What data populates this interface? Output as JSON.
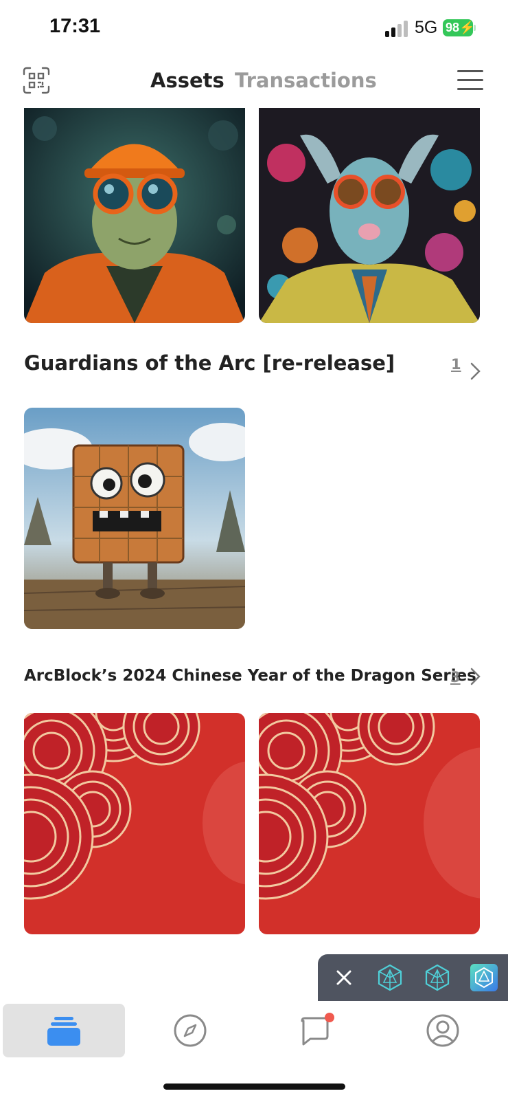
{
  "status_bar": {
    "time": "17:31",
    "network": "5G",
    "battery": "98"
  },
  "header": {
    "tabs": [
      {
        "label": "Assets",
        "active": true
      },
      {
        "label": "Transactions",
        "active": false
      }
    ],
    "scan_icon": "qr-scan-icon",
    "menu_icon": "hamburger-menu-icon"
  },
  "sections": [
    {
      "title": "Guardians of the Arc [re-release]",
      "count": "1",
      "items": [
        "robot-block-nft"
      ]
    },
    {
      "title": "ArcBlock’s 2024 Chinese Year of the Dragon Series",
      "count": "3",
      "items": [
        "dragon-red-envelope-nft",
        "dragon-red-envelope-nft"
      ]
    }
  ],
  "top_items": [
    "frog-goggles-nft",
    "goat-suit-nft"
  ],
  "floating_bar": {
    "close_icon": "close-icon",
    "apps": [
      "arcblock-app-icon",
      "arcblock-app-icon",
      "arcblock-wallet-app-icon"
    ]
  },
  "bottom_nav": [
    {
      "name": "assets",
      "icon": "wallet-stack-icon",
      "active": true
    },
    {
      "name": "explore",
      "icon": "compass-icon",
      "active": false
    },
    {
      "name": "messages",
      "icon": "chat-bubble-icon",
      "active": false,
      "badge": true
    },
    {
      "name": "profile",
      "icon": "user-circle-icon",
      "active": false
    }
  ],
  "colors": {
    "accent": "#3b8ef0",
    "battery": "#34c759",
    "badge": "#f05a4f",
    "dragon_red": "#d2302a",
    "floating_bar": "#4f5460"
  }
}
